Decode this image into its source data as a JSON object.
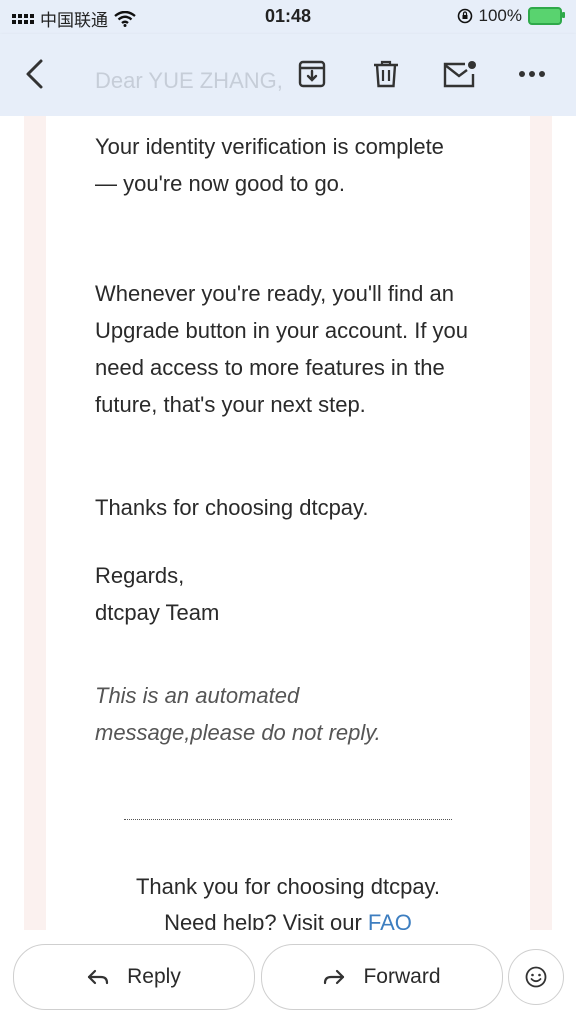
{
  "status": {
    "carrier": "中国联通",
    "time": "01:48",
    "battery": "100%"
  },
  "toolbar": {
    "subject_preview": "Dear YUE ZHANG,",
    "buttons": [
      "back-icon",
      "archive-icon",
      "trash-icon",
      "mark-unread-icon",
      "more-icon"
    ]
  },
  "email": {
    "para1": "Your identity verification is complete — you're now good to go.",
    "para2": "Whenever you're ready, you'll find an Upgrade button in your account. If you need access to more features in the future, that's your next step.",
    "para3": "Thanks for choosing dtcpay.",
    "regards": "Regards,",
    "team": "dtcpay Team",
    "automated": "This is an automated message,please do not reply.",
    "footer_thanks": "Thank you for choosing dtcpay.",
    "help_prefix": "Need help? Visit our ",
    "help_link": "FAQ"
  },
  "actions": {
    "reply_label": "Reply",
    "forward_label": "Forward"
  },
  "colors": {
    "header_bg": "#e7eef9",
    "link": "#3d7ec0",
    "battery": "#59d36f"
  }
}
